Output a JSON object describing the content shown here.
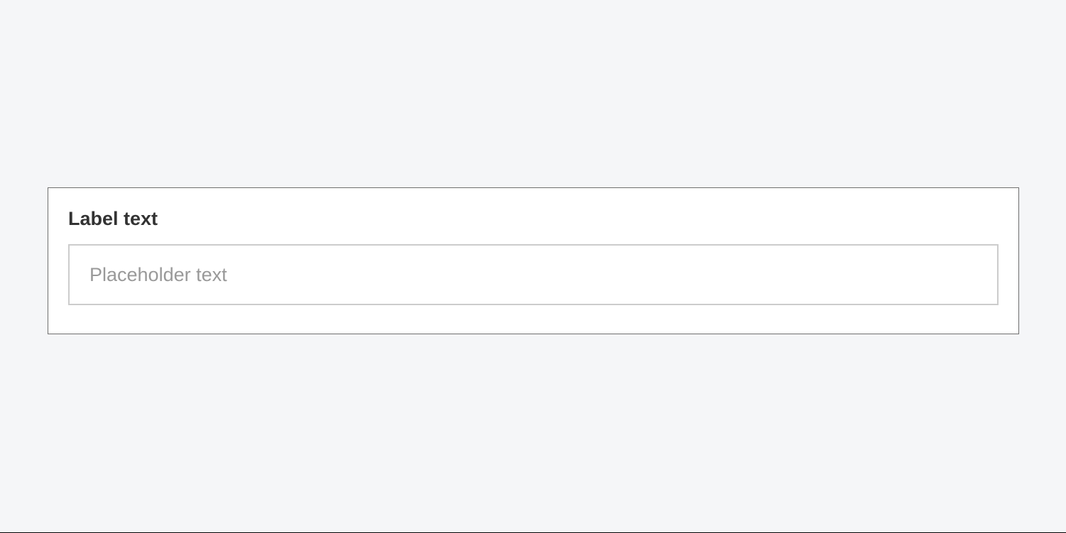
{
  "form": {
    "label": "Label text",
    "input": {
      "placeholder": "Placeholder text",
      "value": ""
    }
  }
}
